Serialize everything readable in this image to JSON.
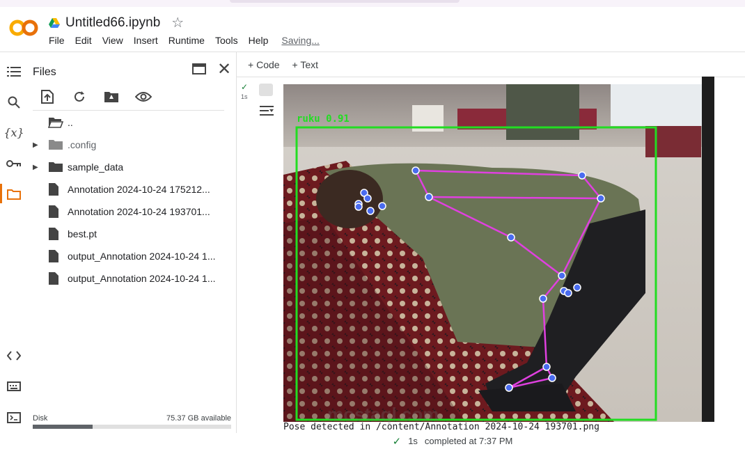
{
  "notebook": {
    "title": "Untitled66.ipynb",
    "menu": [
      "File",
      "Edit",
      "View",
      "Insert",
      "Runtime",
      "Tools",
      "Help"
    ],
    "saving": "Saving..."
  },
  "files_panel": {
    "title": "Files",
    "items": [
      {
        "label": "..",
        "type": "folder-open",
        "expandable": false
      },
      {
        "label": ".config",
        "type": "folder-gray",
        "expandable": true
      },
      {
        "label": "sample_data",
        "type": "folder",
        "expandable": true
      },
      {
        "label": "Annotation 2024-10-24 175212...",
        "type": "file",
        "expandable": false
      },
      {
        "label": "Annotation 2024-10-24 193701...",
        "type": "file",
        "expandable": false
      },
      {
        "label": "best.pt",
        "type": "file",
        "expandable": false
      },
      {
        "label": "output_Annotation 2024-10-24 1...",
        "type": "file",
        "expandable": false
      },
      {
        "label": "output_Annotation 2024-10-24 1...",
        "type": "file",
        "expandable": false
      }
    ],
    "disk_label": "Disk",
    "disk_available": "75.37 GB available",
    "disk_used_fraction": 0.3
  },
  "toolbar": {
    "code_label": "Code",
    "text_label": "Text"
  },
  "cell": {
    "exec_time": "1s",
    "detection_label": "ruku 0.91",
    "output_text": "Pose detected in /content/Annotation 2024-10-24 193701.png"
  },
  "status_bar": {
    "time": "1s",
    "completed": "completed at 7:37 PM"
  },
  "watermark": "mostaql.com",
  "colors": {
    "accent_orange": "#e8710a",
    "box_green": "#22dd22",
    "skeleton_magenta": "#e040e0",
    "keypoint_blue": "#4a6cf0"
  }
}
